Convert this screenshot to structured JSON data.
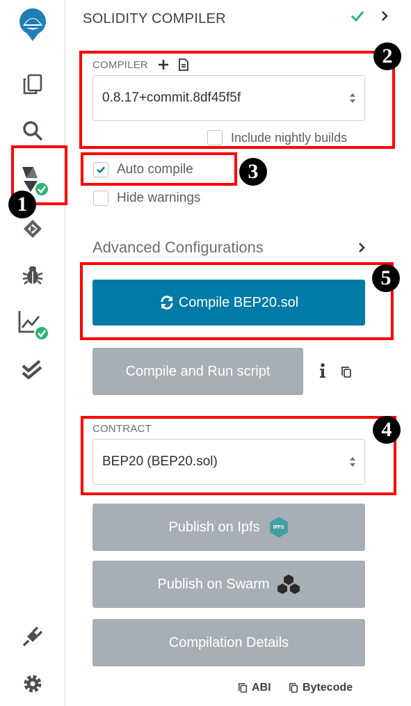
{
  "colors": {
    "accent": "#007aa6",
    "success": "#2fb374",
    "annotation": "#ff0000",
    "gray_button": "#a8aeb5"
  },
  "iconbar": {
    "items": [
      "remix-logo-icon",
      "file-explorer-icon",
      "search-icon",
      "solidity-compiler-icon",
      "deploy-run-icon",
      "debugger-icon",
      "analysis-icon",
      "unit-testing-icon",
      "plugin-manager-icon",
      "settings-icon"
    ]
  },
  "panel": {
    "title": "SOLIDITY COMPILER"
  },
  "compiler": {
    "label": "COMPILER",
    "version": "0.8.17+commit.8df45f5f",
    "nightly_label": "Include nightly builds",
    "nightly_checked": false
  },
  "options": {
    "auto_compile": "Auto compile",
    "auto_compile_checked": true,
    "hide_warnings": "Hide warnings",
    "hide_warnings_checked": false
  },
  "advanced": {
    "label": "Advanced Configurations"
  },
  "buttons": {
    "compile": "Compile BEP20.sol",
    "compile_run": "Compile and Run script",
    "publish_ipfs": "Publish on Ipfs",
    "ipfs_badge": "IPFS",
    "publish_swarm": "Publish on Swarm",
    "details": "Compilation Details"
  },
  "contract": {
    "label": "CONTRACT",
    "selected": "BEP20 (BEP20.sol)"
  },
  "footer": {
    "abi": "ABI",
    "bytecode": "Bytecode"
  },
  "annotations": {
    "m1": "1",
    "m2": "2",
    "m3": "3",
    "m4": "4",
    "m5": "5"
  }
}
